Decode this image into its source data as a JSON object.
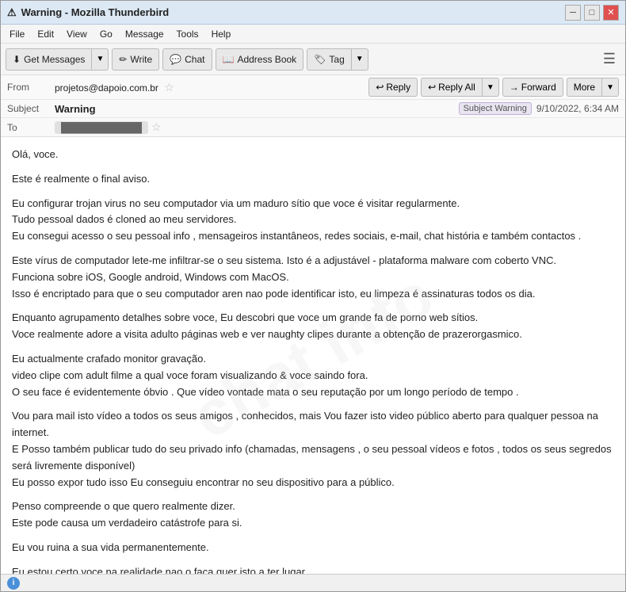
{
  "window": {
    "title": "Warning - Mozilla Thunderbird",
    "icon": "⚠"
  },
  "menu": {
    "items": [
      "File",
      "Edit",
      "View",
      "Go",
      "Message",
      "Tools",
      "Help"
    ]
  },
  "toolbar": {
    "get_messages_label": "Get Messages",
    "write_label": "Write",
    "chat_label": "Chat",
    "address_book_label": "Address Book",
    "tag_label": "Tag",
    "hamburger": "☰"
  },
  "email_header": {
    "from_label": "From",
    "from_value": "projetos@dapoio.com.br",
    "reply_label": "Reply",
    "reply_all_label": "Reply All",
    "forward_label": "Forward",
    "more_label": "More",
    "subject_label": "Subject",
    "subject_value": "Warning",
    "subject_badge": "Subject Warning",
    "date_value": "9/10/2022, 6:34 AM",
    "to_label": "To",
    "to_value": "████████████"
  },
  "email_body": {
    "paragraphs": [
      "Olá, voce.",
      "Este é realmente o final   aviso.",
      "Eu configurar   trojan virus   no seu computador via um maduro sítio  que voce é visitar regularmente.\nTudo  pessoal  dados é cloned ao meu  servidores.\nEu consegui   acesso o seu pessoal info ,  mensageiros instantâneos,  redes sociais, e-mail,  chat história e também  contactos .",
      "Este  vírus de computador lete-me   infiltrar-se  o seu sistema.  Isto é a adjustável - plataforma malware com coberto VNC.\nFunciona sobre iOS, Google android, Windows com  MacOS.\nIsso é   encriptado  para  que o seu computador  aren nao pode identificar isto,  eu  limpeza é assinaturas todos os dia.",
      "Enquanto agrupamento  detalhes sobre voce,  Eu descobri  que voce   um grande  fa de porno  web sítios.\nVoce realmente adore a   visita adulto páginas web e ver  naughty   clipes durante a obtenção de prazerorgasmico.",
      "Eu actualmente  crafado  monitor  gravação.\nvideo clipe  com adult filme  a qual voce  foram visualizando & voce saindo fora.\nO seu  face é evidentemente  óbvio . Que   vídeo  vontade mata  o seu  reputação por um longo período de tempo .",
      "Vou para mail   isto  vídeo a todos os seus amigos ,  conhecidos,  mais  Vou fazer  isto  video público aberto   para  qualquer pessoa  na internet.\n E Posso   também  publicar tudo do seu  privado  info (chamadas, mensagens ,  o seu pessoal vídeos e fotos ,  todos os seus  segredos  será  livremente  disponível)\n Eu posso  expor tudo isso  Eu  conseguiu  encontrar  no seu  dispositivo para a  público.",
      "Penso  compreende  o que quero realmente dizer.\nEste pode causa um verdadeiro catástrofe   para si.",
      "Eu vou   ruina  a sua vida permanentemente.",
      "Eu estou certo  voce na realidade  nao o faça  quer  isto a ter lugar ."
    ]
  },
  "status_bar": {
    "icon_label": "i",
    "text": ""
  },
  "icons": {
    "get_messages": "⬇",
    "write": "✏",
    "chat": "💬",
    "address_book": "📖",
    "tag": "🏷",
    "reply": "↩",
    "reply_all": "↩↩",
    "forward": "→",
    "star": "☆",
    "warning": "⚠"
  }
}
